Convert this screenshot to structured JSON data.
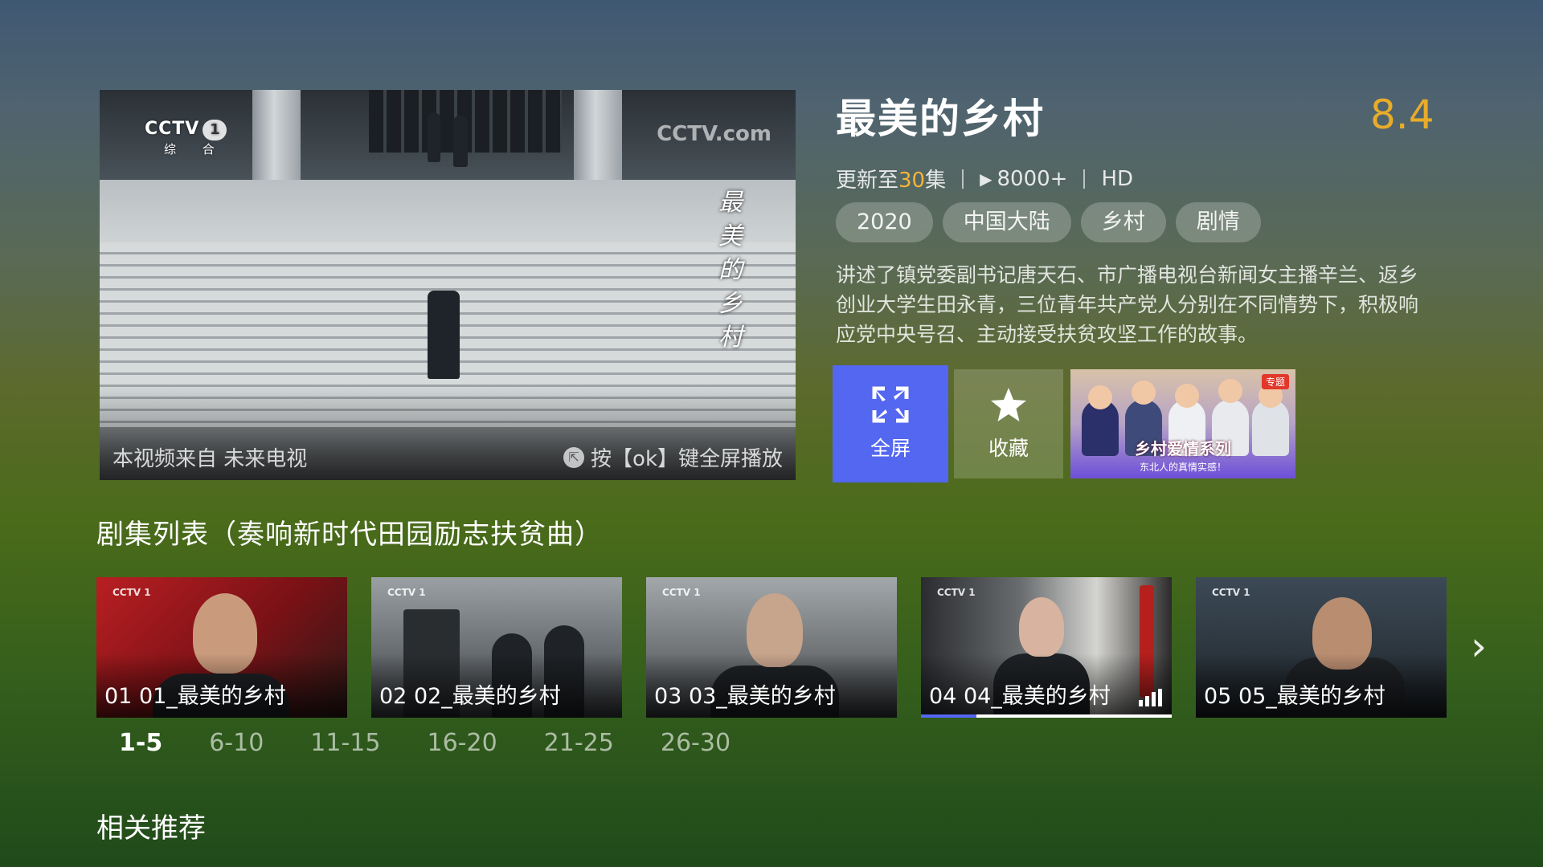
{
  "player": {
    "channel_logo": "CCTV 1",
    "channel_sub": "综 合",
    "watermark": "CCTV.com",
    "video_title_vertical": "最美的乡村",
    "source_text": "本视频来自 未来电视",
    "ok_hint": "按【ok】键全屏播放"
  },
  "show": {
    "title": "最美的乡村",
    "rating": "8.4",
    "update_prefix": "更新至",
    "update_count": "30",
    "update_suffix": "集",
    "play_icon": "▶",
    "plays": "8000+",
    "quality": "HD",
    "tags": [
      "2020",
      "中国大陆",
      "乡村",
      "剧情"
    ],
    "description": "讲述了镇党委副书记唐天石、市广播电视台新闻女主播辛兰、返乡创业大学生田永青，三位青年共产党人分别在不同情势下，积极响应党中央号召、主动接受扶贫攻坚工作的故事。"
  },
  "actions": {
    "fullscreen_label": "全屏",
    "fullscreen_icon": "fullscreen-icon",
    "favorite_label": "收藏",
    "favorite_icon": "star-icon",
    "banner_badge": "专题",
    "banner_title": "乡村爱情系列",
    "banner_subtitle": "东北人的真情实感！"
  },
  "episodes": {
    "heading": "剧集列表（奏响新时代田园励志扶贫曲）",
    "items": [
      {
        "label": "01 01_最美的乡村"
      },
      {
        "label": "02 02_最美的乡村"
      },
      {
        "label": "03 03_最美的乡村"
      },
      {
        "label": "04 04_最美的乡村",
        "playing": true,
        "progress": 0.22
      },
      {
        "label": "05 05_最美的乡村"
      }
    ],
    "next_icon": "chevron-right-icon",
    "ranges": [
      "1-5",
      "6-10",
      "11-15",
      "16-20",
      "21-25",
      "26-30"
    ],
    "active_range": "1-5"
  },
  "recommend": {
    "heading": "相关推荐"
  },
  "colors": {
    "accent": "#5367f0",
    "rating": "#e8ac2a",
    "highlight": "#f2b43a"
  }
}
